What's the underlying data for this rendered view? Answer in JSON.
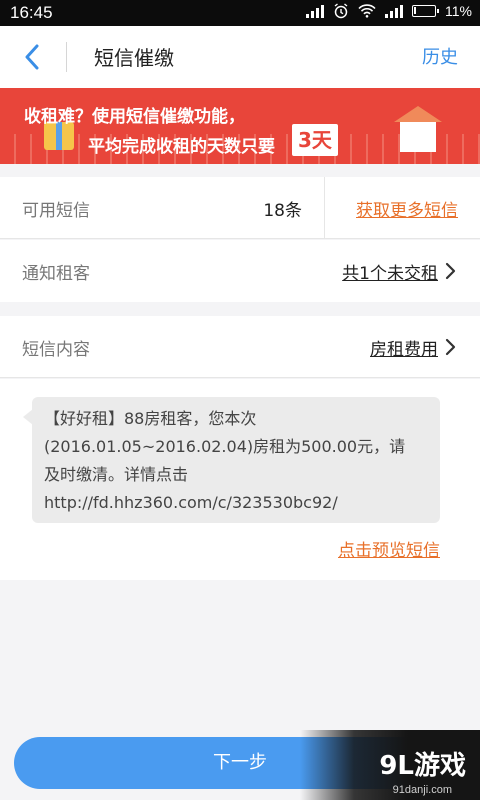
{
  "status_bar": {
    "time": "16:45",
    "battery": "11%",
    "battery_level": 0.11
  },
  "navbar": {
    "title": "短信催缴",
    "history_label": "历史",
    "back_icon": "back-arrow-icon",
    "accent_color": "#3a8ee6"
  },
  "banner": {
    "line1": "收租难？使用短信催缴功能，",
    "line2": "平均完成收租的天数只要",
    "days": "3天",
    "background_color": "#e8453a"
  },
  "sms_balance": {
    "label": "可用短信",
    "count": "18条",
    "link": "获取更多短信"
  },
  "notify": {
    "label": "通知租客",
    "value": "共1个未交租"
  },
  "sms_content": {
    "label": "短信内容",
    "value": "房租费用"
  },
  "message": {
    "lines": [
      "【好好租】88房租客，您本次",
      "(2016.01.05~2016.02.04)房租为500.00元，请",
      "及时缴清。详情点击",
      "http://fd.hhz360.com/c/323530bc92/"
    ],
    "preview_link": "点击预览短信"
  },
  "next_button": {
    "label": "下一步",
    "color": "#4a9bf0"
  },
  "watermark": {
    "main": "9L游戏",
    "sub": "91danji.com"
  },
  "colors": {
    "link_orange": "#e8702a"
  }
}
